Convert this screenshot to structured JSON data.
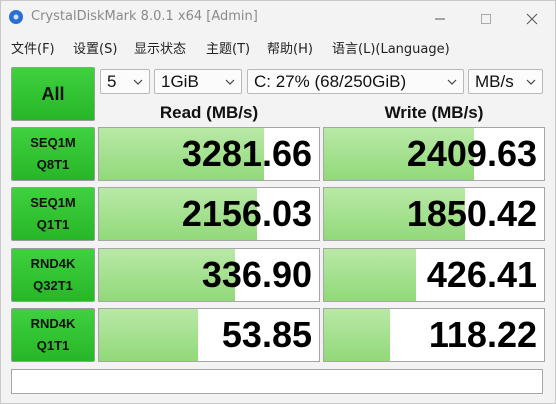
{
  "window": {
    "title": "CrystalDiskMark 8.0.1 x64 [Admin]"
  },
  "menu": [
    "文件(F)",
    "设置(S)",
    "显示状态",
    "主题(T)",
    "帮助(H)",
    "语言(L)(Language)"
  ],
  "controls": {
    "all_label": "All",
    "count": "5",
    "size": "1GiB",
    "drive": "C: 27% (68/250GiB)",
    "unit": "MB/s"
  },
  "headers": {
    "read": "Read (MB/s)",
    "write": "Write (MB/s)"
  },
  "rows": [
    {
      "line1": "SEQ1M",
      "line2": "Q8T1",
      "read": "3281.66",
      "write": "2409.63",
      "read_fill": 0.75,
      "write_fill": 0.68
    },
    {
      "line1": "SEQ1M",
      "line2": "Q1T1",
      "read": "2156.03",
      "write": "1850.42",
      "read_fill": 0.72,
      "write_fill": 0.64
    },
    {
      "line1": "RND4K",
      "line2": "Q32T1",
      "read": "336.90",
      "write": "426.41",
      "read_fill": 0.62,
      "write_fill": 0.42
    },
    {
      "line1": "RND4K",
      "line2": "Q1T1",
      "read": "53.85",
      "write": "118.22",
      "read_fill": 0.45,
      "write_fill": 0.3
    }
  ],
  "colors": {
    "button_green": "#2fc42f",
    "bar_green": "#a4e18d"
  }
}
